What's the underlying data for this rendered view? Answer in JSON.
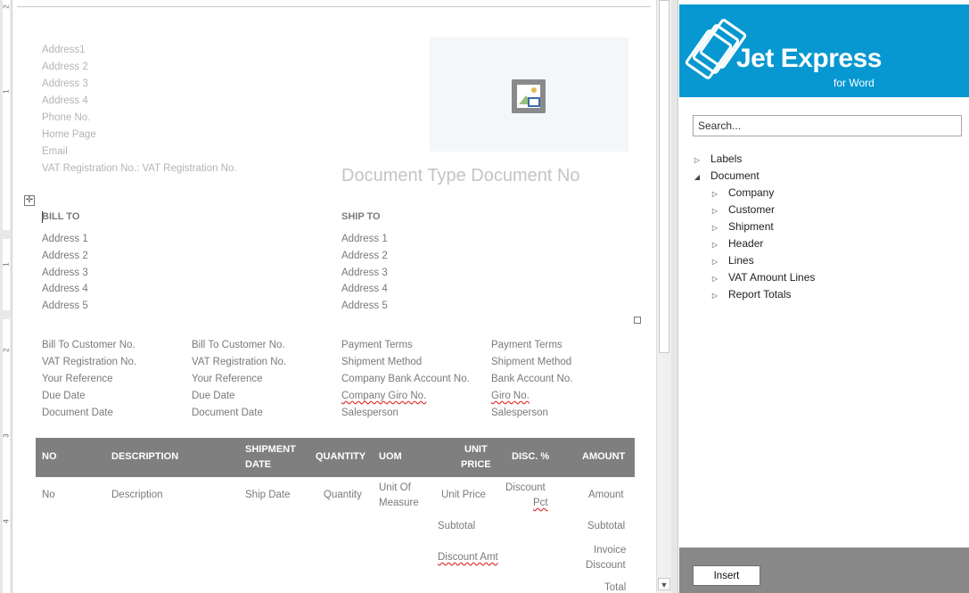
{
  "company_address": [
    "Address1",
    "Address 2",
    "Address 3",
    "Address 4",
    "Phone No.",
    "Home Page",
    "Email",
    "VAT Registration No.:  VAT Registration No."
  ],
  "document_title": "Document Type Document No",
  "bill_to": {
    "heading": "BILL TO",
    "lines": [
      "Address 1",
      "Address 2",
      "Address 3",
      "Address 4",
      "Address 5"
    ]
  },
  "ship_to": {
    "heading": "SHIP TO",
    "lines": [
      "Address 1",
      "Address 2",
      "Address 3",
      "Address 4",
      "Address 5"
    ]
  },
  "info": {
    "col1": [
      "Bill To Customer No.",
      "VAT Registration No.",
      "Your Reference",
      "Due Date",
      "Document Date"
    ],
    "col2": [
      "Bill To Customer No.",
      "VAT Registration No.",
      "Your Reference",
      "Due Date",
      "Document Date"
    ],
    "col3": [
      "Payment Terms",
      "Shipment Method",
      "Company Bank Account No.",
      "Company Giro No.",
      "Salesperson"
    ],
    "col4": [
      "Payment Terms",
      "Shipment Method",
      "Bank Account No.",
      "Giro No.",
      "Salesperson"
    ]
  },
  "table": {
    "headers": {
      "no": "NO",
      "description": "DESCRIPTION",
      "shipment": [
        "SHIPMENT",
        "DATE"
      ],
      "quantity": "QUANTITY",
      "uom": "UOM",
      "unit_price": [
        "UNIT",
        "PRICE"
      ],
      "disc": "DISC. %",
      "amount": "AMOUNT"
    },
    "row": {
      "no": "No",
      "description": "Description",
      "ship_date": "Ship Date",
      "quantity": "Quantity",
      "uom": [
        "Unit Of",
        "Measure"
      ],
      "unit_price": "Unit Price",
      "discount": [
        "Discount",
        "Pct"
      ],
      "amount": "Amount"
    },
    "totals": {
      "subtotal_label": "Subtotal",
      "subtotal_value": "Subtotal",
      "discount_label": "Discount Amt",
      "invoice_discount": [
        "Invoice",
        "Discount"
      ],
      "total": "Total"
    }
  },
  "ruler_numbers": [
    "2",
    "1",
    "1",
    "2",
    "3",
    "4"
  ],
  "pane": {
    "brand": "Jet Express",
    "brand_sub": "for Word",
    "search_placeholder": "Search...",
    "tree": [
      {
        "label": "Labels",
        "expanded": false,
        "level": 0
      },
      {
        "label": "Document",
        "expanded": true,
        "level": 0
      },
      {
        "label": "Company",
        "expanded": false,
        "level": 1
      },
      {
        "label": "Customer",
        "expanded": false,
        "level": 1
      },
      {
        "label": "Shipment",
        "expanded": false,
        "level": 1
      },
      {
        "label": "Header",
        "expanded": false,
        "level": 1
      },
      {
        "label": "Lines",
        "expanded": false,
        "level": 1
      },
      {
        "label": "VAT Amount Lines",
        "expanded": false,
        "level": 1
      },
      {
        "label": "Report Totals",
        "expanded": false,
        "level": 1
      }
    ],
    "insert_label": "Insert",
    "accent": "#0798d1"
  }
}
